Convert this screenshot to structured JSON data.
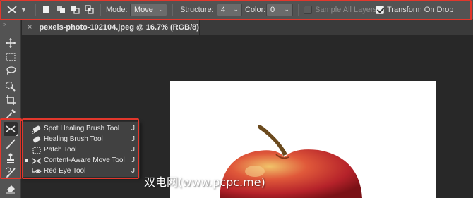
{
  "options_bar": {
    "tool_preset_icon": "content-aware-move-icon",
    "mode": {
      "label": "Mode:",
      "value": "Move"
    },
    "structure": {
      "label": "Structure:",
      "value": "4"
    },
    "color": {
      "label": "Color:",
      "value": "0"
    },
    "sample_all_layers": {
      "label": "Sample All Layers",
      "checked": false,
      "enabled": false
    },
    "transform_on_drop": {
      "label": "Transform On Drop",
      "checked": true
    }
  },
  "document_tab": {
    "close": "×",
    "title": "pexels-photo-102104.jpeg @ 16.7% (RGB/8)"
  },
  "toolbar": {
    "tools": [
      "move-tool-icon",
      "marquee-tool-icon",
      "lasso-tool-icon",
      "quick-selection-tool-icon",
      "crop-tool-icon",
      "eyedropper-tool-icon",
      "content-aware-move-tool-icon",
      "brush-tool-icon",
      "clone-stamp-tool-icon",
      "history-brush-tool-icon",
      "eraser-tool-icon"
    ]
  },
  "flyout": {
    "items": [
      {
        "label": "Spot Healing Brush Tool",
        "key": "J",
        "icon": "spot-healing-brush-icon",
        "selected": false
      },
      {
        "label": "Healing Brush Tool",
        "key": "J",
        "icon": "healing-brush-icon",
        "selected": false
      },
      {
        "label": "Patch Tool",
        "key": "J",
        "icon": "patch-tool-icon",
        "selected": false
      },
      {
        "label": "Content-Aware Move Tool",
        "key": "J",
        "icon": "content-aware-move-icon",
        "selected": true
      },
      {
        "label": "Red Eye Tool",
        "key": "J",
        "icon": "red-eye-icon",
        "selected": false
      }
    ]
  },
  "watermark": "双电网(www.pcpc.me)",
  "colors": {
    "highlight": "#e2372c",
    "panel": "#535353",
    "canvas": "#282828"
  }
}
